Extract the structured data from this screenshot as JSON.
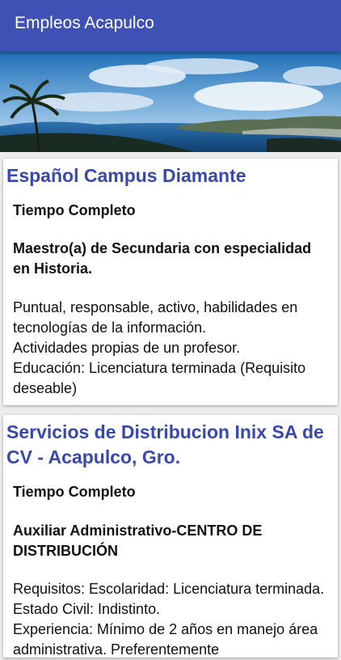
{
  "app_bar": {
    "title": "Empleos Acapulco",
    "accent_color": "#3f51b5"
  },
  "banner": {
    "image": "acapulco-bay-with-palm-tree"
  },
  "listings": [
    {
      "company": "Español Campus Diamante",
      "schedule": "Tiempo Completo",
      "position": "Maestro(a) de Secundaria con especialidad en Historia.",
      "description": "Puntual, responsable, activo, habilidades en tecnologías de la información.\nActividades propias de un profesor.\nEducación:  Licenciatura terminada (Requisito deseable)"
    },
    {
      "company": "Servicios de Distribucion Inix SA de CV - Acapulco, Gro.",
      "schedule": "Tiempo Completo",
      "position": "Auxiliar Administrativo-CENTRO DE DISTRIBUCIÓN",
      "description": "Requisitos:  Escolaridad: Licenciatura terminada. Estado Civil: Indistinto.\nExperiencia: Mínimo de 2 años en manejo área administrativa. Preferentemente"
    }
  ]
}
